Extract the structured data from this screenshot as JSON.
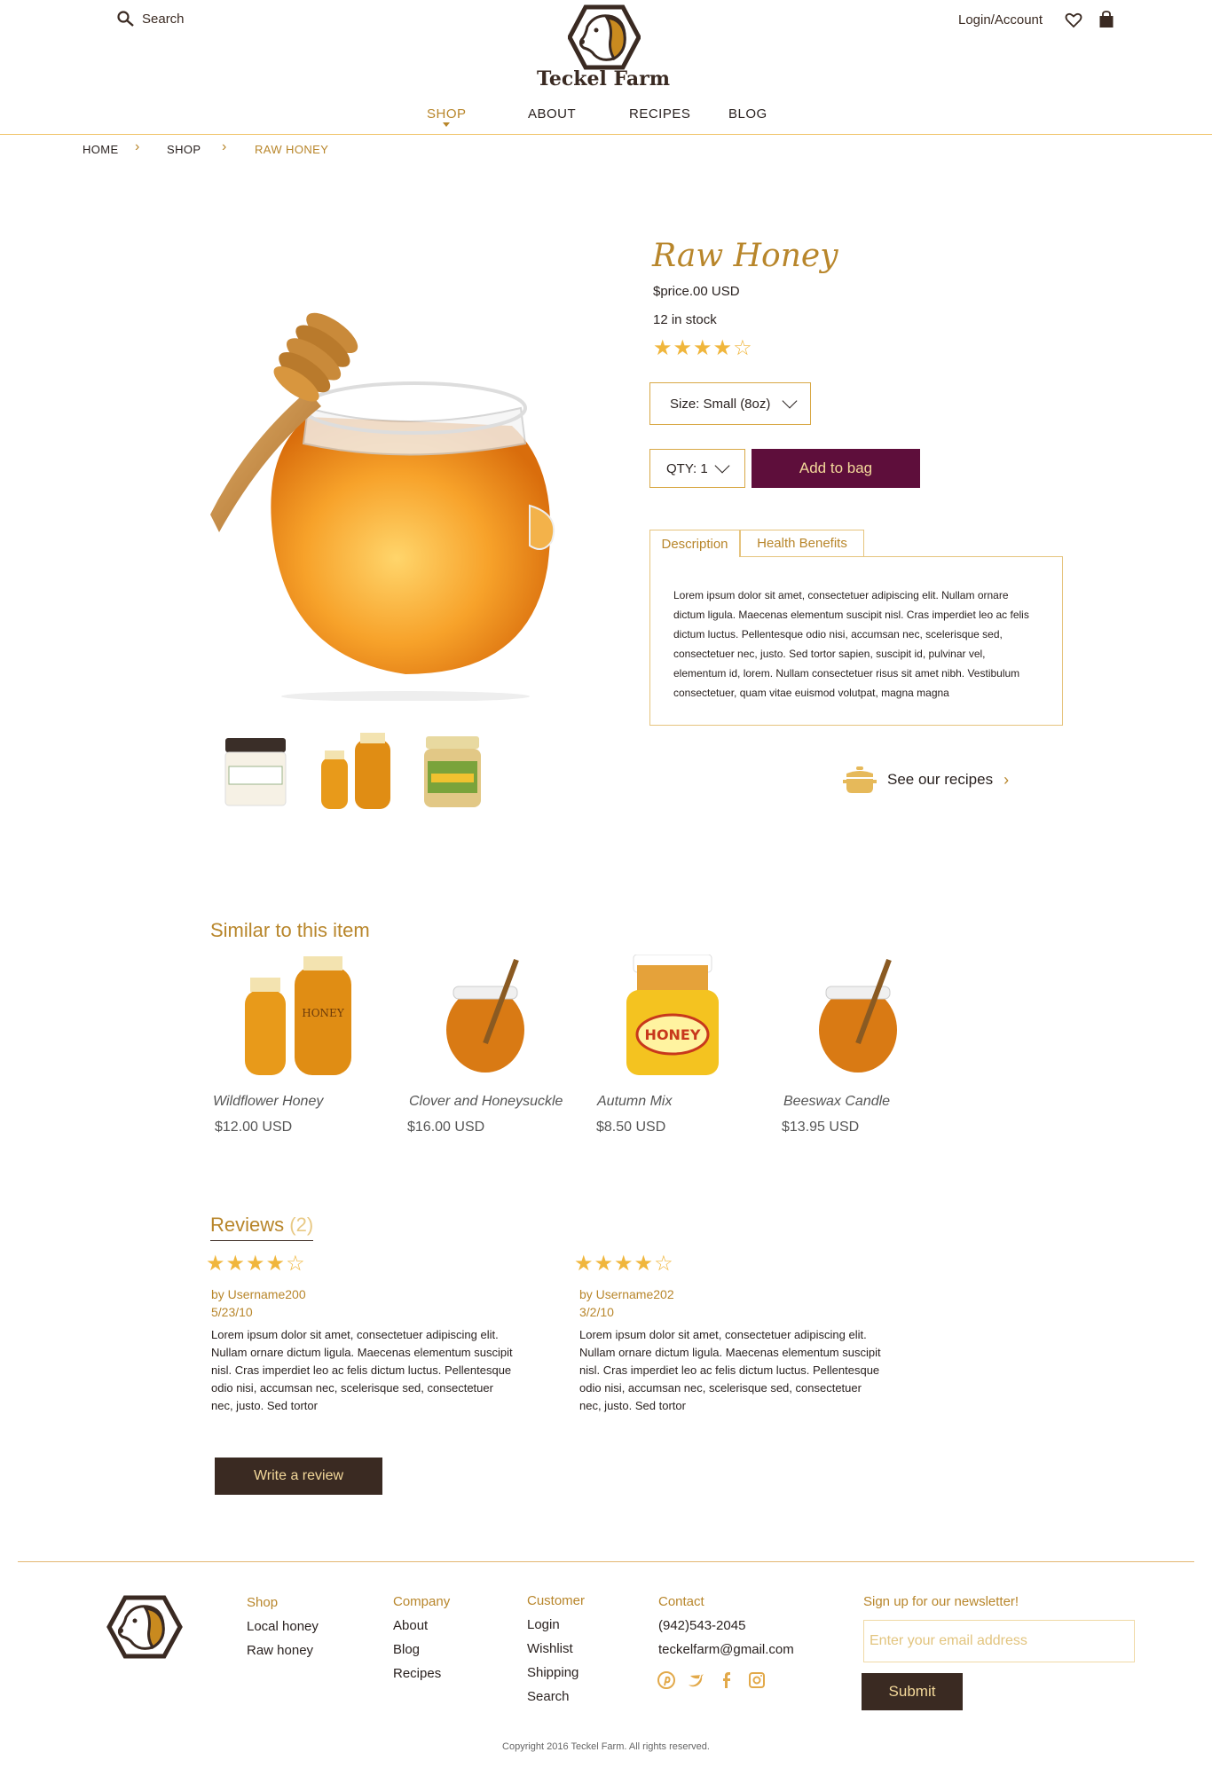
{
  "header": {
    "search_label": "Search",
    "brand": "Teckel Farm",
    "account_label": "Login/Account",
    "nav": [
      {
        "label": "SHOP",
        "active": true
      },
      {
        "label": "ABOUT"
      },
      {
        "label": "RECIPES"
      },
      {
        "label": "BLOG"
      }
    ]
  },
  "breadcrumb": [
    "HOME",
    "SHOP",
    "RAW HONEY"
  ],
  "product": {
    "title": "Raw Honey",
    "price": "$price.00 USD",
    "stock": "12 in stock",
    "rating": 4,
    "rating_max": 5,
    "size_select": "Size: Small (8oz)",
    "qty_select": "QTY: 1",
    "add_label": "Add to bag",
    "tabs": [
      "Description",
      "Health Benefits"
    ],
    "description": "Lorem ipsum dolor sit amet, consectetuer adipiscing elit. Nullam ornare dictum ligula. Maecenas elementum suscipit nisl. Cras imperdiet leo ac felis dictum luctus. Pellentesque odio nisi, accumsan nec, scelerisque sed, consectetuer nec, justo. Sed tortor sapien, suscipit id, pulvinar vel, elementum id, lorem. Nullam consectetuer risus sit amet nibh. Vestibulum consectetuer, quam vitae euismod volutpat, magna magna",
    "recipes_link": "See our recipes"
  },
  "similar": {
    "title": "Similar to this item",
    "items": [
      {
        "name": "Wildflower Honey",
        "price": "$12.00 USD"
      },
      {
        "name": "Clover and Honeysuckle",
        "price": "$16.00 USD"
      },
      {
        "name": "Autumn Mix",
        "price": "$8.50 USD"
      },
      {
        "name": "Beeswax Candle",
        "price": "$13.95 USD"
      }
    ]
  },
  "reviews": {
    "title": "Reviews",
    "count": "(2)",
    "items": [
      {
        "rating": 4,
        "user": "by Username200",
        "date": "5/23/10",
        "text": "Lorem ipsum dolor sit amet, consectetuer adipiscing elit. Nullam ornare dictum ligula. Maecenas elementum suscipit nisl. Cras imperdiet leo ac felis dictum luctus. Pellentesque odio nisi, accumsan nec, scelerisque sed, consectetuer nec, justo. Sed tortor"
      },
      {
        "rating": 4,
        "user": "by Username202",
        "date": "3/2/10",
        "text": "Lorem ipsum dolor sit amet, consectetuer adipiscing elit. Nullam ornare dictum ligula. Maecenas elementum suscipit nisl. Cras imperdiet leo ac felis dictum luctus. Pellentesque odio nisi, accumsan nec, scelerisque sed, consectetuer nec, justo. Sed tortor"
      }
    ],
    "write_label": "Write a review"
  },
  "footer": {
    "shop": {
      "title": "Shop",
      "links": [
        "Local honey",
        "Raw honey"
      ]
    },
    "company": {
      "title": "Company",
      "links": [
        "About",
        "Blog",
        "Recipes"
      ]
    },
    "customer": {
      "title": "Customer",
      "links": [
        "Login",
        "Wishlist",
        "Shipping",
        "Search"
      ]
    },
    "contact": {
      "title": "Contact",
      "phone": "(942)543-2045",
      "email": "teckelfarm@gmail.com"
    },
    "newsletter": {
      "title": "Sign up for our newsletter!",
      "placeholder": "Enter your email address",
      "submit": "Submit"
    },
    "copyright": "Copyright 2016 Teckel Farm. All rights reserved."
  },
  "colors": {
    "gold": "#b8862b",
    "plum": "#5e0e3b",
    "brown": "#3a2a22",
    "star": "#f0b63c"
  }
}
